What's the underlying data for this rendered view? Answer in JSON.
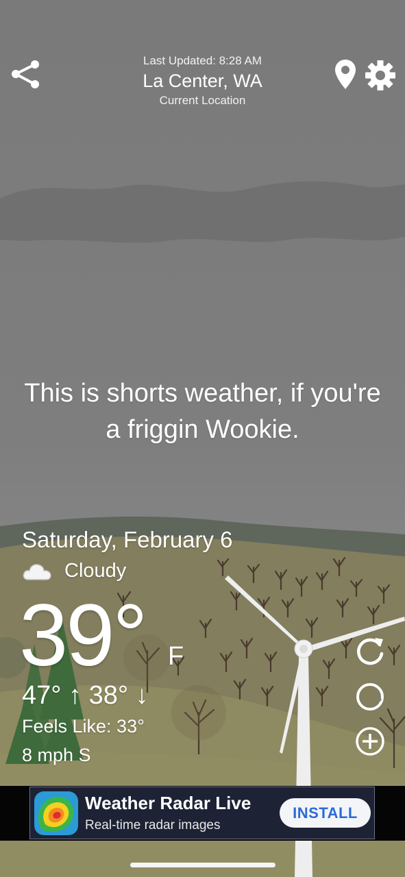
{
  "header": {
    "last_updated": "Last Updated: 8:28 AM",
    "city": "La Center, WA",
    "location_label": "Current Location"
  },
  "quote": "This is shorts weather, if you're a friggin Wookie.",
  "current": {
    "date": "Saturday, February 6",
    "condition": "Cloudy",
    "temperature": "39°",
    "unit": "F",
    "high_low": "47° ↑ 38° ↓",
    "feels_like": "Feels Like: 33°",
    "wind": "8 mph S"
  },
  "ad": {
    "title": "Weather Radar Live",
    "subtitle": "Real-time radar images",
    "install_label": "INSTALL"
  },
  "icons": [
    "share-icon",
    "location-pin-icon",
    "gear-icon",
    "cloud-icon",
    "refresh-icon",
    "moon-icon",
    "add-icon"
  ],
  "colors": {
    "sky": "#7e7e7e",
    "hills": "#8a8663",
    "ad_button_text": "#2a6bd8"
  }
}
